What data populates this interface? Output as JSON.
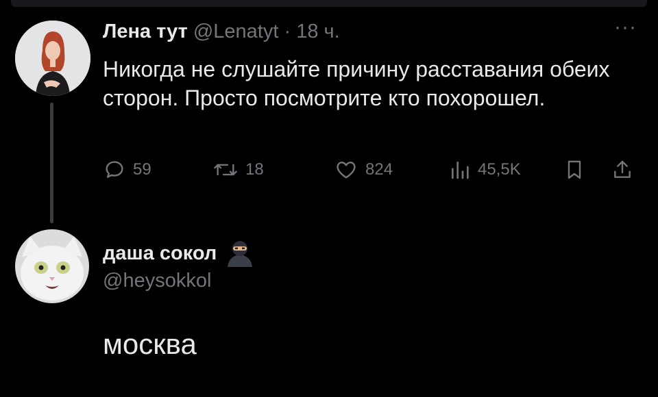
{
  "tweet": {
    "author_name": "Лена тут",
    "author_handle": "@Lenatyt",
    "separator": "·",
    "time": "18 ч.",
    "more_label": "···",
    "text": "Никогда не слушайте причину расставания обеих сторон. Просто посмотрите кто похорошел.",
    "actions": {
      "replies": "59",
      "reposts": "18",
      "likes": "824",
      "views": "45,5K"
    }
  },
  "reply": {
    "author_name": "даша сокол",
    "author_handle": "@heysokkol",
    "emoji_icon": "ninja-emoji",
    "text": "москва"
  },
  "colors": {
    "background": "#000000",
    "text_primary": "#e7e9ea",
    "text_secondary": "#71767b",
    "thread_line": "#3a3c40"
  }
}
